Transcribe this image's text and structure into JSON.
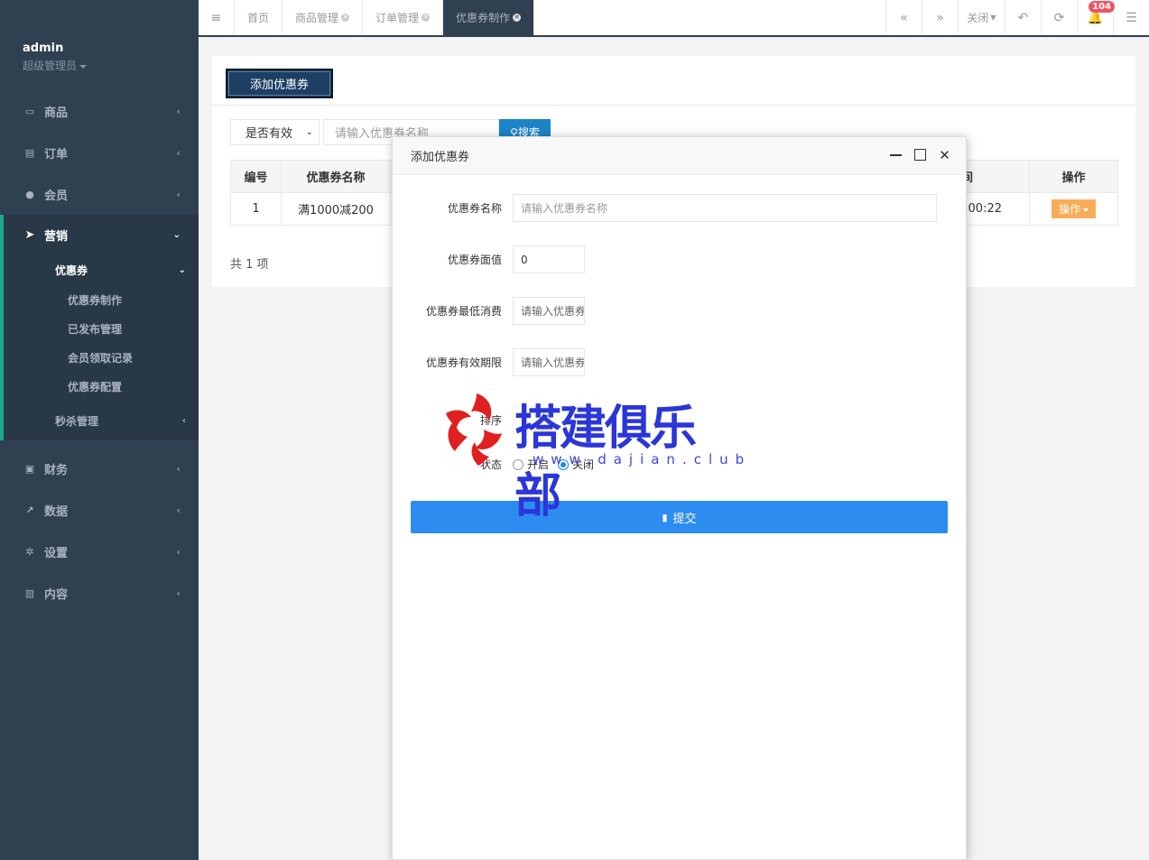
{
  "sidebar": {
    "user": "admin",
    "role": "超级管理员",
    "menu": [
      {
        "label": "商品",
        "icon": "laptop-icon"
      },
      {
        "label": "订单",
        "icon": "document-icon"
      },
      {
        "label": "会员",
        "icon": "user-icon"
      }
    ],
    "active": {
      "label": "营销",
      "sub_label": "优惠券",
      "sub_items": [
        "优惠券制作",
        "已发布管理",
        "会员领取记录",
        "优惠券配置"
      ],
      "sub_other": "秒杀管理"
    },
    "menu_bottom": [
      {
        "label": "财务",
        "icon": "money-icon"
      },
      {
        "label": "数据",
        "icon": "chart-icon"
      },
      {
        "label": "设置",
        "icon": "gear-icon"
      },
      {
        "label": "内容",
        "icon": "book-icon"
      }
    ]
  },
  "tabs": {
    "items": [
      "首页",
      "商品管理",
      "订单管理",
      "优惠券制作"
    ],
    "close_label": "关闭",
    "badge": "104"
  },
  "toolbar": {
    "add_label": "添加优惠券",
    "filter_select": "是否有效",
    "search_placeholder": "请输入优惠券名称",
    "search_label": "搜索"
  },
  "table": {
    "headers": [
      "编号",
      "优惠券名称",
      "间",
      "操作"
    ],
    "rows": [
      {
        "id": "1",
        "name": "满1000减200",
        "time": ":00:22",
        "op": "操作"
      }
    ],
    "total": "共 1 项"
  },
  "modal": {
    "title": "添加优惠券",
    "fields": {
      "name_label": "优惠券名称",
      "name_placeholder": "请输入优惠券名称",
      "value_label": "优惠券面值",
      "value_value": "0",
      "min_label": "优惠券最低消费",
      "min_placeholder": "请输入优惠券",
      "expire_label": "优惠券有效期限",
      "expire_placeholder": "请输入优惠券",
      "sort_label": "排序",
      "status_label": "状态",
      "status_on": "开启",
      "status_off": "关闭"
    },
    "submit_label": "提交"
  },
  "watermark": {
    "text": "搭建俱乐部",
    "url": "www.dajian.club"
  }
}
